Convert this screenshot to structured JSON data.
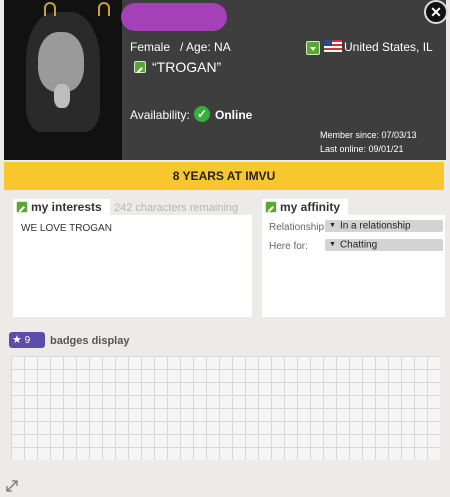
{
  "profile": {
    "gender": "Female",
    "age_label": "/ Age: NA",
    "location": "United States, IL",
    "tagline": "“TROGAN”",
    "availability_label": "Availability:",
    "availability_status": "Online",
    "member_since": "Member since: 07/03/13",
    "last_online": "Last online: 09/01/21"
  },
  "banner": {
    "years": "8 YEARS AT IMVU"
  },
  "interests": {
    "title": "my interests",
    "remaining": "242 characters remaining",
    "text": "WE LOVE TROGAN"
  },
  "affinity": {
    "title": "my affinity",
    "relationship_label": "Relationship:",
    "relationship_value": "In a relationship",
    "here_for_label": "Here for:",
    "here_for_value": "Chatting"
  },
  "badges": {
    "count": "9",
    "title": "badges display"
  },
  "icons": {
    "close": "close-icon",
    "edit": "pencil-icon",
    "dropdown": "chevron-down-icon",
    "flag": "us-flag-icon",
    "online": "check-icon",
    "badge": "star-icon",
    "resize": "resize-icon"
  },
  "colors": {
    "name_bar": "#a540b8",
    "banner": "#f8c72d",
    "accent_green": "#5aa632",
    "header_bg": "#3e3e3e"
  }
}
